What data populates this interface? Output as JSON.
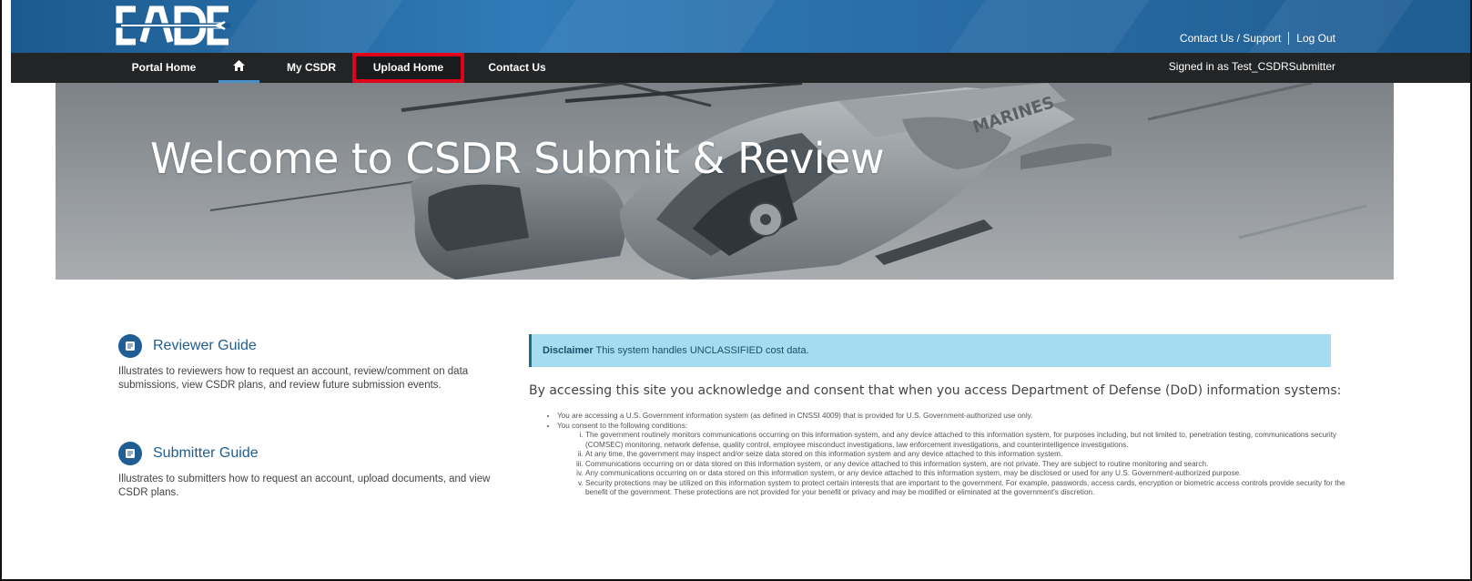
{
  "header": {
    "contact_support": "Contact Us / Support",
    "logout": "Log Out",
    "signed_in": "Signed in as Test_CSDRSubmitter"
  },
  "nav": {
    "items": [
      {
        "label": "Portal Home"
      },
      {
        "label": "home-icon"
      },
      {
        "label": "My CSDR"
      },
      {
        "label": "Upload Home"
      },
      {
        "label": "Contact Us"
      }
    ],
    "highlight_color": "#e0001b"
  },
  "hero": {
    "title": "Welcome to CSDR Submit & Review",
    "helicopter_marking": "MARINES"
  },
  "guides": [
    {
      "title": "Reviewer Guide",
      "description": "Illustrates to reviewers how to request an account, review/comment on data submissions, view CSDR plans, and review future submission events."
    },
    {
      "title": "Submitter Guide",
      "description": "Illustrates to submitters how to request an account, upload documents, and view CSDR plans."
    }
  ],
  "disclaimer": {
    "label": "Disclaimer",
    "text": "This system handles UNCLASSIFIED cost data."
  },
  "consent": {
    "intro": "By accessing this site you acknowledge and consent that when you access Department of Defense (DoD) information systems:",
    "bullet1": "You are accessing a U.S. Government information system (as defined in CNSSI 4009) that is provided for U.S. Government-authorized use only.",
    "bullet2": "You consent to the following conditions:",
    "conditions": [
      "The government routinely monitors communications occurring on this information system, and any device attached to this information system, for purposes including, but not limited to, penetration testing, communications security (COMSEC) monitoring, network defense, quality control, employee misconduct investigations, law enforcement investigations, and counterintelligence investigations.",
      "At any time, the government may inspect and/or seize data stored on this information system and any device attached to this information system.",
      "Communications occurring on or data stored on this information system, or any device attached to this information system, are not private. They are subject to routine monitoring and search.",
      "Any communications occurring on or data stored on this information system, or any device attached to this information system, may be disclosed or used for any U.S. Government-authorized purpose.",
      "Security protections may be utilized on this information system to protect certain interests that are important to the government. For example, passwords, access cards, encryption or biometric access controls provide security for the benefit of the government. These protections are not provided for your benefit or privacy and may be modified or eliminated at the government's discretion."
    ]
  },
  "colors": {
    "banner": "#2f7ab8",
    "navbar": "#222426",
    "accent": "#1f5d92",
    "disclaimer_bg": "#a6dcef"
  }
}
